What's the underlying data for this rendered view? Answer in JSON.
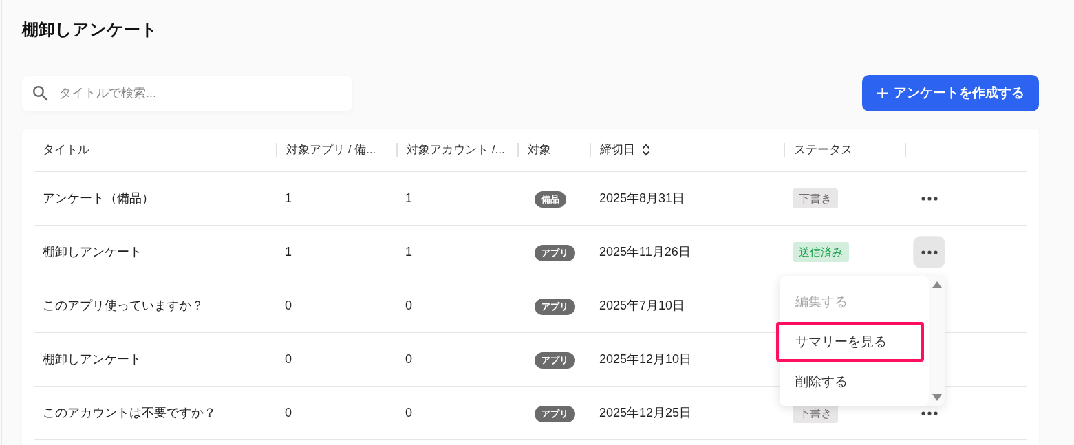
{
  "page": {
    "title": "棚卸しアンケート"
  },
  "search": {
    "placeholder": "タイトルで検索..."
  },
  "create_button": {
    "label": "アンケートを作成する"
  },
  "table": {
    "columns": [
      {
        "label": "タイトル",
        "sortable": false
      },
      {
        "label": "対象アプリ / 備...",
        "sortable": false
      },
      {
        "label": "対象アカウント /...",
        "sortable": false
      },
      {
        "label": "対象",
        "sortable": false
      },
      {
        "label": "締切日",
        "sortable": true
      },
      {
        "label": "ステータス",
        "sortable": false
      }
    ],
    "rows": [
      {
        "title": "アンケート（備品）",
        "apps": "1",
        "accounts": "1",
        "target": "備品",
        "deadline": "2025年8月31日",
        "status": {
          "label": "下書き",
          "kind": "draft"
        },
        "actions": {
          "open": false
        }
      },
      {
        "title": "棚卸しアンケート",
        "apps": "1",
        "accounts": "1",
        "target": "アプリ",
        "deadline": "2025年11月26日",
        "status": {
          "label": "送信済み",
          "kind": "sent"
        },
        "actions": {
          "open": true
        }
      },
      {
        "title": "このアプリ使っていますか？",
        "apps": "0",
        "accounts": "0",
        "target": "アプリ",
        "deadline": "2025年7月10日"
      },
      {
        "title": "棚卸しアンケート",
        "apps": "0",
        "accounts": "0",
        "target": "アプリ",
        "deadline": "2025年12月10日"
      },
      {
        "title": "このアカウントは不要ですか？",
        "apps": "0",
        "accounts": "0",
        "target": "アプリ",
        "deadline": "2025年12月25日",
        "status": {
          "label": "下書き",
          "kind": "draft"
        },
        "actions": {
          "open": false
        }
      }
    ]
  },
  "menu": {
    "items": [
      {
        "label": "編集する",
        "disabled": true,
        "highlighted": false
      },
      {
        "label": "サマリーを見る",
        "disabled": false,
        "highlighted": true
      },
      {
        "label": "削除する",
        "disabled": false,
        "highlighted": false
      }
    ]
  }
}
